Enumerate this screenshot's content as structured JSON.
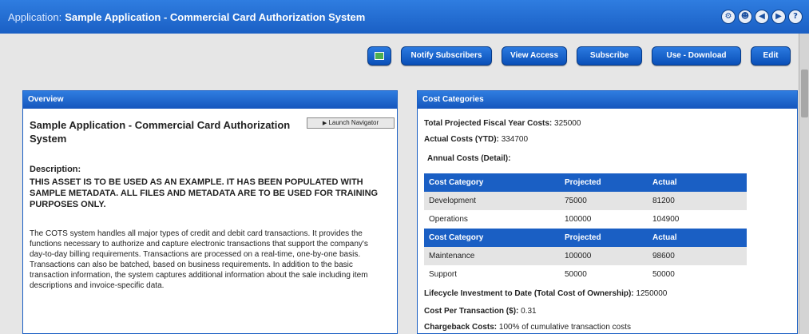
{
  "header": {
    "app_prefix": "Application:",
    "app_name": "Sample Application - Commercial Card Authorization System",
    "icons": [
      {
        "name": "settings-icon",
        "glyph": "⚙"
      },
      {
        "name": "user-icon",
        "glyph": "☻"
      },
      {
        "name": "back-icon",
        "glyph": "◀"
      },
      {
        "name": "forward-icon",
        "glyph": "▶"
      },
      {
        "name": "help-icon",
        "glyph": "?"
      }
    ]
  },
  "toolbar": {
    "icon_button": "screen-icon",
    "buttons": [
      "Notify Subscribers",
      "View Access",
      "Subscribe",
      "Use - Download",
      "Edit"
    ]
  },
  "overview": {
    "heading": "Overview",
    "title": "Sample Application - Commercial Card Authorization System",
    "launch_label": "Launch Navigator",
    "description_label": "Description:",
    "description_upper": "THIS ASSET IS TO BE USED AS AN EXAMPLE. IT HAS BEEN POPULATED WITH SAMPLE METADATA. ALL FILES AND METADATA ARE TO BE USED FOR TRAINING PURPOSES ONLY.",
    "description_body": "The COTS system handles all major types of credit and debit card transactions. It provides the functions necessary to authorize and capture electronic transactions that support the company's day-to-day billing requirements. Transactions are processed on a real-time, one-by-one basis. Transactions can also be batched, based on business requirements. In addition to the basic transaction information, the system captures additional information about the sale including item descriptions and invoice-specific data."
  },
  "costs": {
    "heading": "Cost Categories",
    "total_projected_label": "Total Projected Fiscal Year Costs:",
    "total_projected_value": "325000",
    "actual_label": "Actual Costs (YTD):",
    "actual_value": "334700",
    "annual_label": "Annual Costs (Detail):",
    "columns": [
      "Cost Category",
      "Projected",
      "Actual"
    ],
    "table1": [
      [
        "Development",
        "75000",
        "81200"
      ],
      [
        "Operations",
        "100000",
        "104900"
      ]
    ],
    "table2": [
      [
        "Maintenance",
        "100000",
        "98600"
      ],
      [
        "Support",
        "50000",
        "50000"
      ]
    ],
    "lifecycle_label": "Lifecycle Investment to Date (Total Cost of Ownership):",
    "lifecycle_value": "1250000",
    "cpt_label": "Cost Per Transaction ($):",
    "cpt_value": "0.31",
    "chargeback_label": "Chargeback Costs:",
    "chargeback_value": "100% of cumulative transaction costs"
  }
}
